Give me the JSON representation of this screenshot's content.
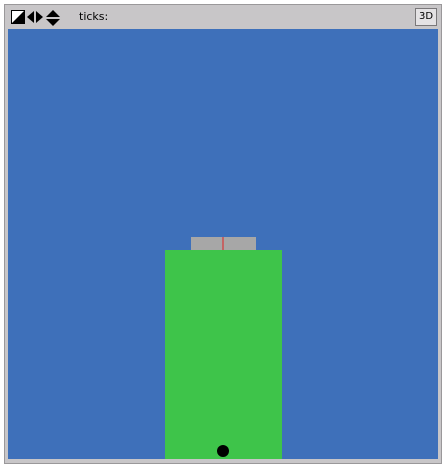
{
  "toolbar": {
    "icons": [
      {
        "name": "edit-mode-icon"
      },
      {
        "name": "move-horizontal-icon"
      },
      {
        "name": "move-vertical-icon"
      }
    ],
    "ticks_label": "ticks:",
    "ticks_value": "",
    "button_3d_label": "3D"
  },
  "world": {
    "background_color": "#3e70ba",
    "ground_color": "#3ec44a",
    "platform_color": "#a7a7a7",
    "marker_color": "#e02020",
    "ball_color": "#000000"
  }
}
